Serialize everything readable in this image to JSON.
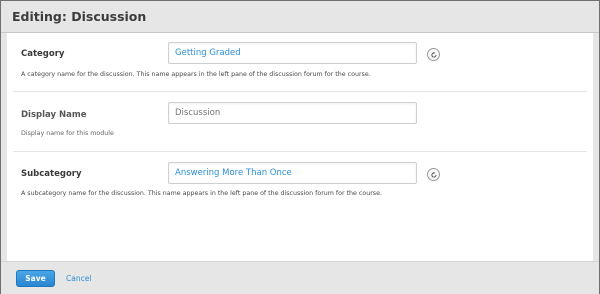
{
  "window": {
    "title": "Editing: Discussion"
  },
  "fields": [
    {
      "label": "Category",
      "value": "Getting Graded",
      "placeholder": "",
      "description": "A category name for the discussion. This name appears in the left pane of the discussion forum for the course.",
      "has_reset": true
    },
    {
      "label": "Display Name",
      "value": "",
      "placeholder": "Discussion",
      "description": "Display name for this module",
      "has_reset": false
    },
    {
      "label": "Subcategory",
      "value": "Answering More Than Once",
      "placeholder": "",
      "description": "A subcategory name for the discussion. This name appears in the left pane of the discussion forum for the course.",
      "has_reset": true
    }
  ],
  "footer": {
    "save_label": "Save",
    "cancel_label": "Cancel"
  },
  "colors": {
    "accent": "#2c8fd4",
    "header_bg": "#e6e6e6",
    "button": "#2a86cf"
  },
  "icons": {
    "reset": "undo-arrow-icon"
  }
}
